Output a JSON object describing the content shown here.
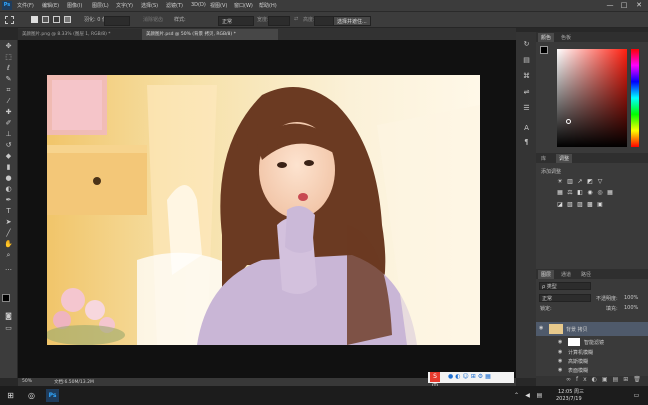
{
  "app": {
    "logo": "Ps"
  },
  "menubar": {
    "items": [
      "文件(F)",
      "编辑(E)",
      "图像(I)",
      "图层(L)",
      "文字(Y)",
      "选择(S)",
      "滤镜(T)",
      "3D(D)",
      "视图(V)",
      "窗口(W)",
      "帮助(H)"
    ]
  },
  "window_controls": {
    "minimize": "—",
    "maximize": "□",
    "close": "✕"
  },
  "options": {
    "feather_label": "羽化: 0 像素",
    "antialias_label": "消除锯齿",
    "style_label": "样式:",
    "style_value": "正常",
    "width_label": "宽度:",
    "height_label": "高度:",
    "select_mask_button": "选择并遮住..."
  },
  "tabs": [
    {
      "label": "美颜图片.png @ 8.33% (图层 1, RGB/8) *"
    },
    {
      "label": "美颜图片.psd @ 50% (背景 拷贝, RGB/8) *"
    }
  ],
  "status": {
    "zoom": "50%",
    "doc": "文档:6.50M/13.2M"
  },
  "panels": {
    "color_tabs": [
      "颜色",
      "色板"
    ],
    "adjust_tabs": [
      "库",
      "调整"
    ],
    "adjust_title": "添加调整",
    "layers_tabs": [
      "图层",
      "通道",
      "路径"
    ],
    "kind_label": "ρ 类型",
    "blend_mode": "正常",
    "opacity_label": "不透明度:",
    "opacity_value": "100%",
    "lock_label": "锁定:",
    "fill_label": "填充:",
    "fill_value": "100%",
    "layers": [
      {
        "name": "背景 拷贝"
      },
      {
        "name": "智能滤镜"
      },
      {
        "name": "计算机模糊"
      },
      {
        "name": "高斯模糊"
      },
      {
        "name": "表面模糊"
      }
    ]
  },
  "taskbar": {
    "time": "12:05 周三",
    "date": "2023/7/19",
    "ime": "S 中"
  },
  "colors": {
    "accent_blue": "#31a8ff",
    "photo_warm": "#f2d8a8",
    "sweater_lavender": "#c9b6d6",
    "hair_brown": "#6b3a22"
  }
}
